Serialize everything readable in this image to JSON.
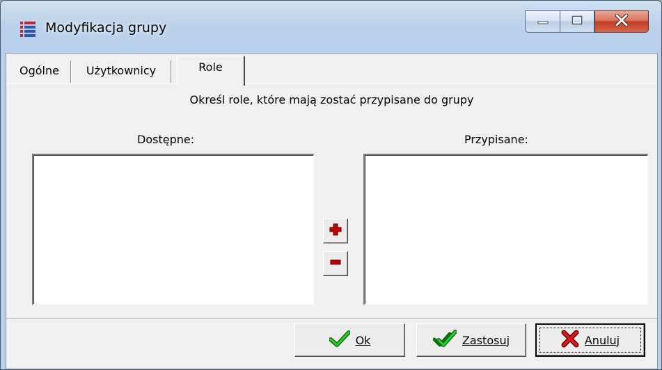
{
  "window": {
    "title": "Modyfikacja grupy",
    "icon": "app-grid-icon",
    "controls": {
      "minimize": "minimize-icon",
      "maximize": "maximize-icon",
      "close": "close-icon"
    }
  },
  "tabs": [
    {
      "label": "Ogólne",
      "active": false
    },
    {
      "label": "Użytkownicy",
      "active": false
    },
    {
      "label": "Role",
      "active": true
    }
  ],
  "panel": {
    "instruction": "Określ role, które mają zostać przypisane do grupy",
    "available_label": "Dostępne:",
    "assigned_label": "Przypisane:",
    "available_items": [],
    "assigned_items": [],
    "add_icon": "plus-icon",
    "remove_icon": "minus-icon"
  },
  "buttons": {
    "ok": "Ok",
    "apply": "Zastosuj",
    "cancel": "Anuluj"
  },
  "colors": {
    "title_bar": "#b9d1ea",
    "close_button": "#c43b22",
    "dialog_face": "#f0f0f0",
    "plus_minus": "#c00000",
    "check_green": "#1d9b1d",
    "cross_red": "#cc1111"
  }
}
